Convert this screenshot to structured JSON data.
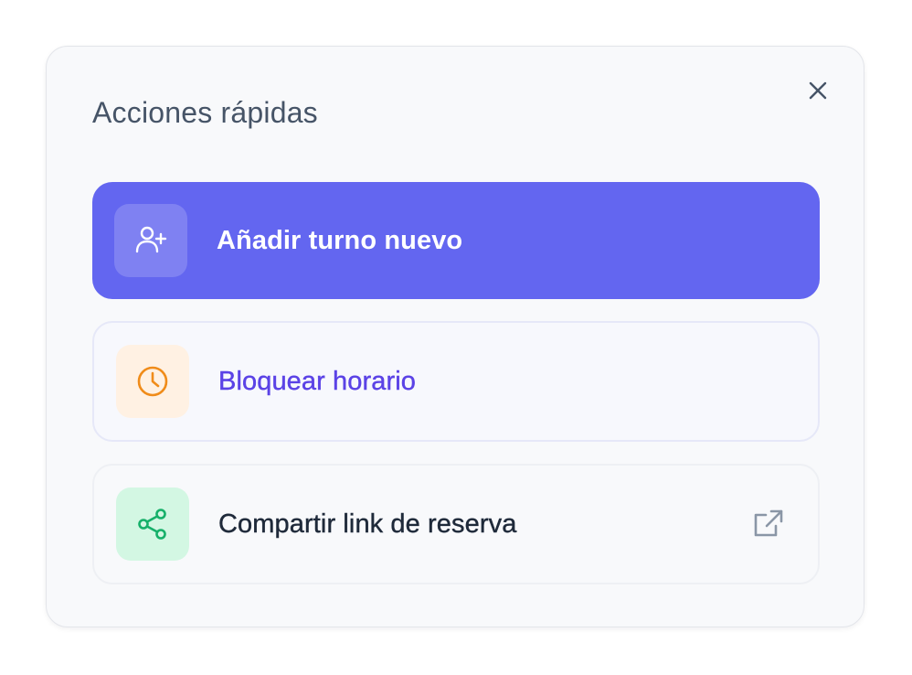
{
  "modal": {
    "title": "Acciones rápidas",
    "close_icon": "close-icon"
  },
  "actions": [
    {
      "label": "Añadir turno nuevo",
      "icon": "user-plus-icon",
      "style": "primary",
      "background": "#6366f0",
      "text_color": "#ffffff"
    },
    {
      "label": "Bloquear horario",
      "icon": "clock-icon",
      "icon_color": "#f08c1a",
      "text_color": "#5b43e6"
    },
    {
      "label": "Compartir link de reserva",
      "icon": "share-icon",
      "icon_color": "#16b06a",
      "text_color": "#1f2a3a",
      "trailing_icon": "external-link-icon"
    }
  ]
}
